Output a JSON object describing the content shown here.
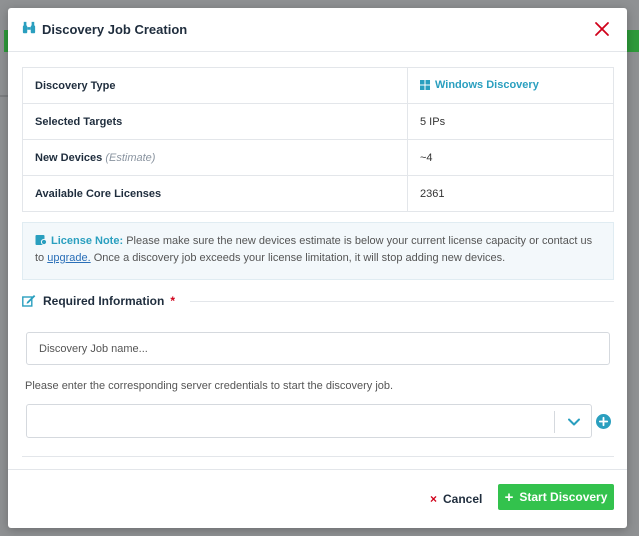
{
  "dialog": {
    "title": "Discovery Job Creation"
  },
  "summary": {
    "rows": [
      {
        "label": "Discovery Type",
        "value": "Windows Discovery"
      },
      {
        "label": "Selected Targets",
        "value": "5 IPs"
      },
      {
        "label": "New Devices",
        "label_note": "(Estimate)",
        "value": "~4"
      },
      {
        "label": "Available Core Licenses",
        "value": "2361"
      }
    ]
  },
  "license_note": {
    "title": "License Note:",
    "text_before": " Please make sure the new devices estimate is below your current license capacity or contact us to ",
    "link": "upgrade.",
    "text_after": " Once a discovery job exceeds your license limitation, it will stop adding new devices."
  },
  "required_section": {
    "title": "Required Information",
    "required_marker": "*",
    "job_name_placeholder": "Discovery Job name...",
    "credentials_hint": "Please enter the corresponding server credentials to start the discovery job.",
    "credentials_value": ""
  },
  "footer": {
    "cancel_label": "Cancel",
    "cancel_icon": "×",
    "start_label": "Start Discovery",
    "start_icon": "+"
  },
  "colors": {
    "accent": "#2a9fbf",
    "primary_button": "#33c24d",
    "danger": "#d0021b",
    "license_value": "#c0392b"
  }
}
